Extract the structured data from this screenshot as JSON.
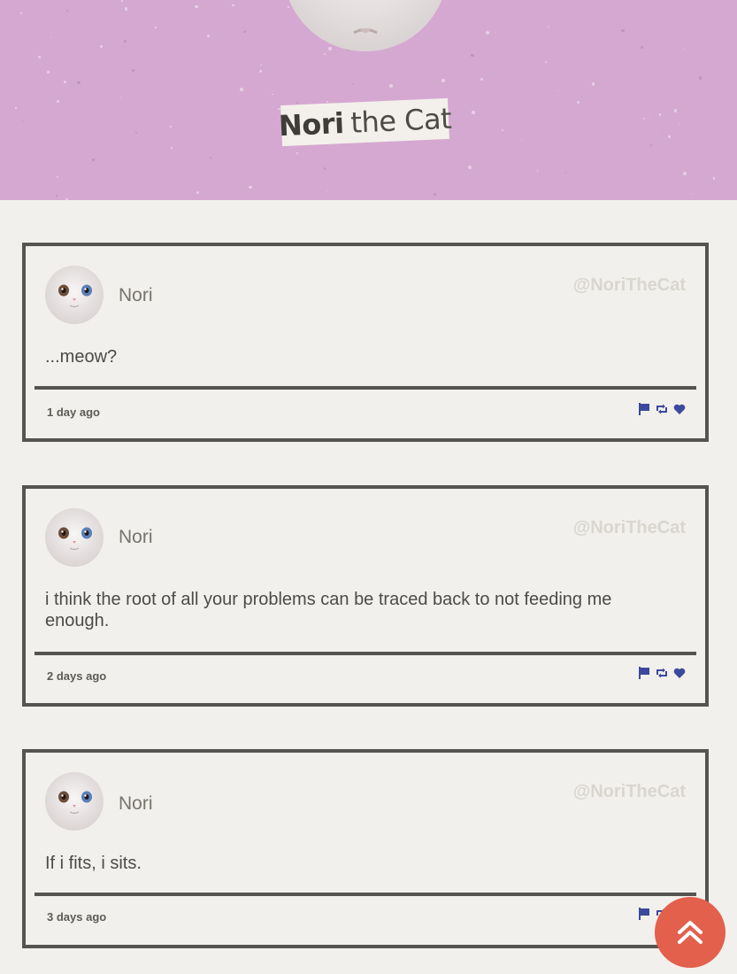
{
  "header": {
    "title_bold": "Nori",
    "title_rest": "the Cat",
    "background_color": "#d5a8d1"
  },
  "posts": [
    {
      "name": "Nori",
      "handle": "@NoriTheCat",
      "text": "...meow?",
      "time": "1 day ago"
    },
    {
      "name": "Nori",
      "handle": "@NoriTheCat",
      "text": "i think the root of all your problems can be traced back to not feeding me enough.",
      "time": "2 days ago"
    },
    {
      "name": "Nori",
      "handle": "@NoriTheCat",
      "text": "If i fits, i sits.",
      "time": "3 days ago"
    }
  ],
  "icons": {
    "report": "flag-icon",
    "retweet": "retweet-icon",
    "like": "heart-icon",
    "back_to_top": "double-chevron-up-icon",
    "action_color": "#3b4a9c",
    "back_to_top_color": "#e2604c"
  }
}
